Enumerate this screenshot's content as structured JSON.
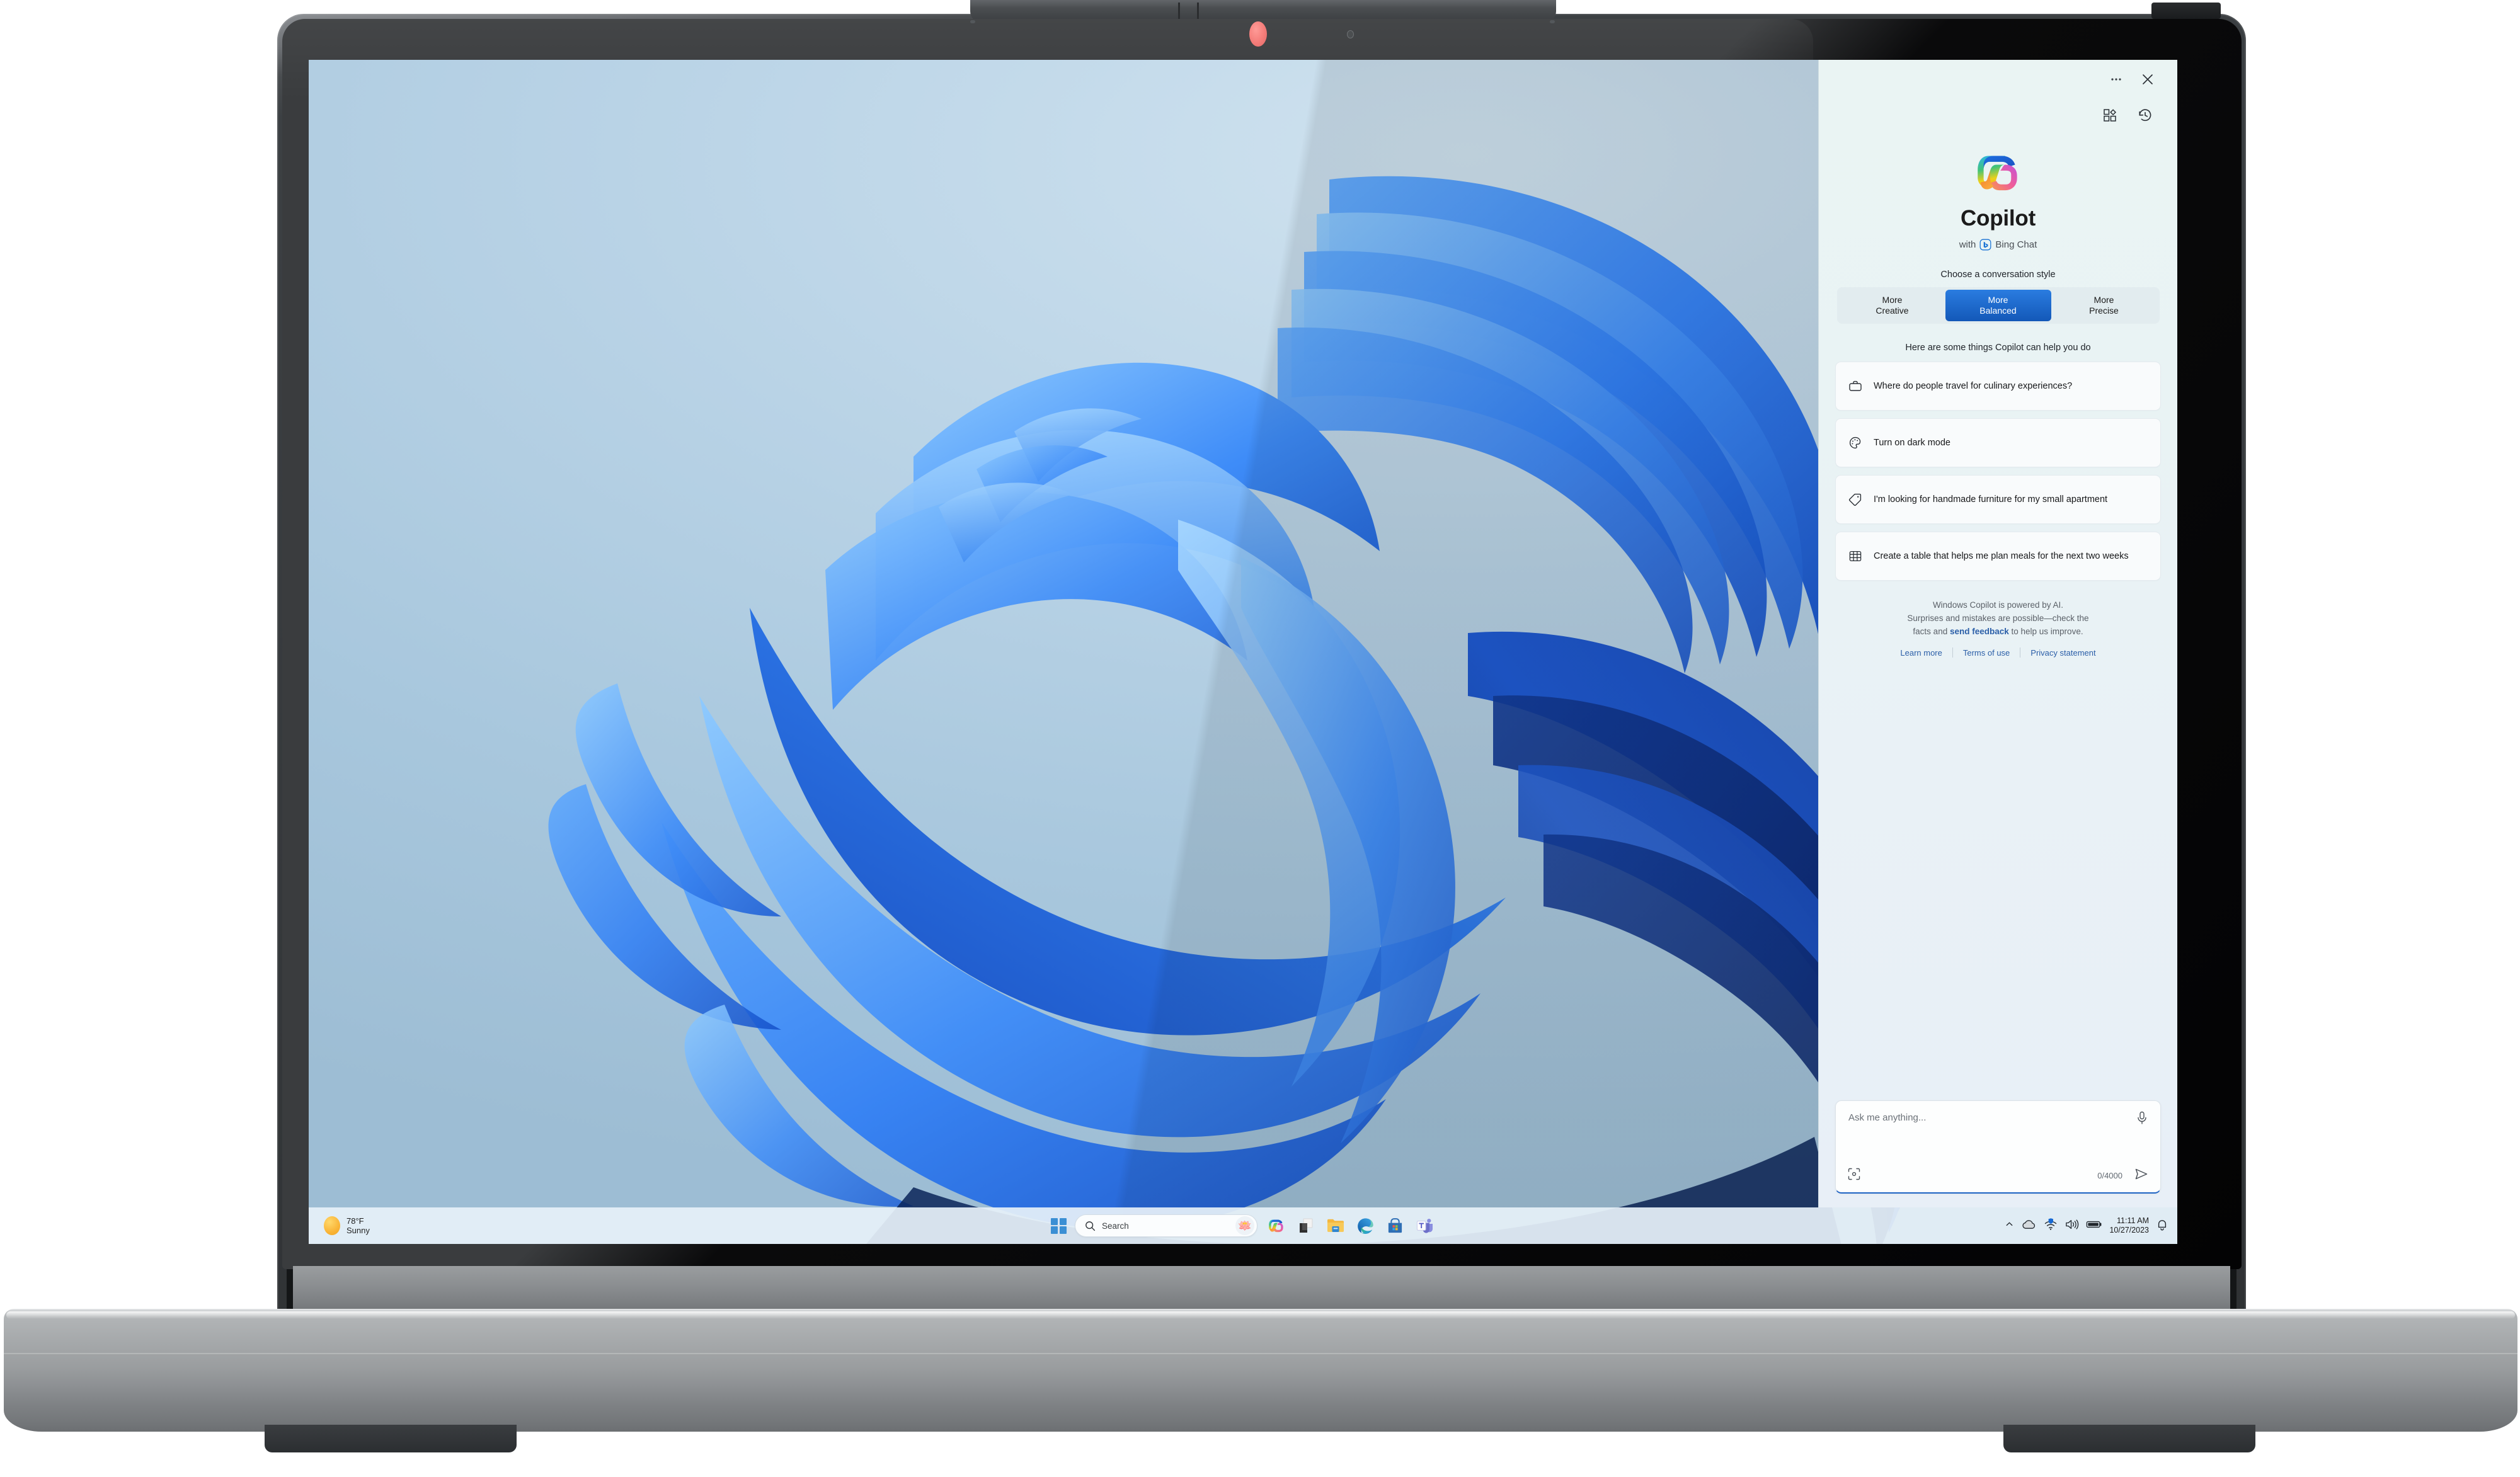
{
  "copilot": {
    "titlebar": {
      "more_label": "…",
      "close_label": "×"
    },
    "toolbar": {
      "plugins_label": "Plugins",
      "history_label": "History"
    },
    "app_name": "Copilot",
    "subtitle_prefix": "with",
    "subtitle_brand": "Bing Chat",
    "style_section_label": "Choose a conversation style",
    "styles": [
      {
        "line1": "More",
        "line2": "Creative",
        "active": false
      },
      {
        "line1": "More",
        "line2": "Balanced",
        "active": true
      },
      {
        "line1": "More",
        "line2": "Precise",
        "active": false
      }
    ],
    "help_label": "Here are some things Copilot can help you do",
    "cards": [
      {
        "icon": "briefcase-icon",
        "text": "Where do people travel for culinary experiences?"
      },
      {
        "icon": "palette-icon",
        "text": "Turn on dark mode"
      },
      {
        "icon": "tag-icon",
        "text": "I'm looking for handmade furniture for my small apartment"
      },
      {
        "icon": "table-icon",
        "text": "Create a table that helps me plan meals for the next two weeks"
      }
    ],
    "disclaimer": {
      "line1": "Windows Copilot is powered by AI.",
      "line2": "Surprises and mistakes are possible—check the",
      "line3_pre": "facts and ",
      "link": "send feedback",
      "line3_post": " to help us improve."
    },
    "footer_links": [
      {
        "label": "Learn more"
      },
      {
        "label": "Terms of use"
      },
      {
        "label": "Privacy statement"
      }
    ],
    "composer": {
      "placeholder": "Ask me anything...",
      "char_count": "0/4000",
      "mic_name": "microphone-icon",
      "scan_name": "scan-icon",
      "send_name": "send-icon"
    },
    "accent": "#1358b8",
    "link_color": "#2b5fa8"
  },
  "taskbar": {
    "weather": {
      "temperature": "78°F",
      "condition": "Sunny"
    },
    "start_label": "Start",
    "search": {
      "placeholder": "Search",
      "value": ""
    },
    "apps": [
      {
        "name": "copilot-taskbar-icon"
      },
      {
        "name": "file-explorer-widget-icon"
      },
      {
        "name": "file-explorer-icon"
      },
      {
        "name": "edge-icon"
      },
      {
        "name": "microsoft-store-icon"
      },
      {
        "name": "teams-icon"
      }
    ],
    "tray": {
      "overflow_label": "^",
      "onedrive_name": "cloud-icon",
      "network_name": "wifi-icon",
      "volume_name": "speaker-icon",
      "battery_name": "battery-icon",
      "time": "11:11 AM",
      "date": "10/27/2023",
      "notifications_name": "bell-icon"
    }
  },
  "device": {
    "camera_name": "webcam",
    "camera_led_name": "camera-privacy-led"
  }
}
